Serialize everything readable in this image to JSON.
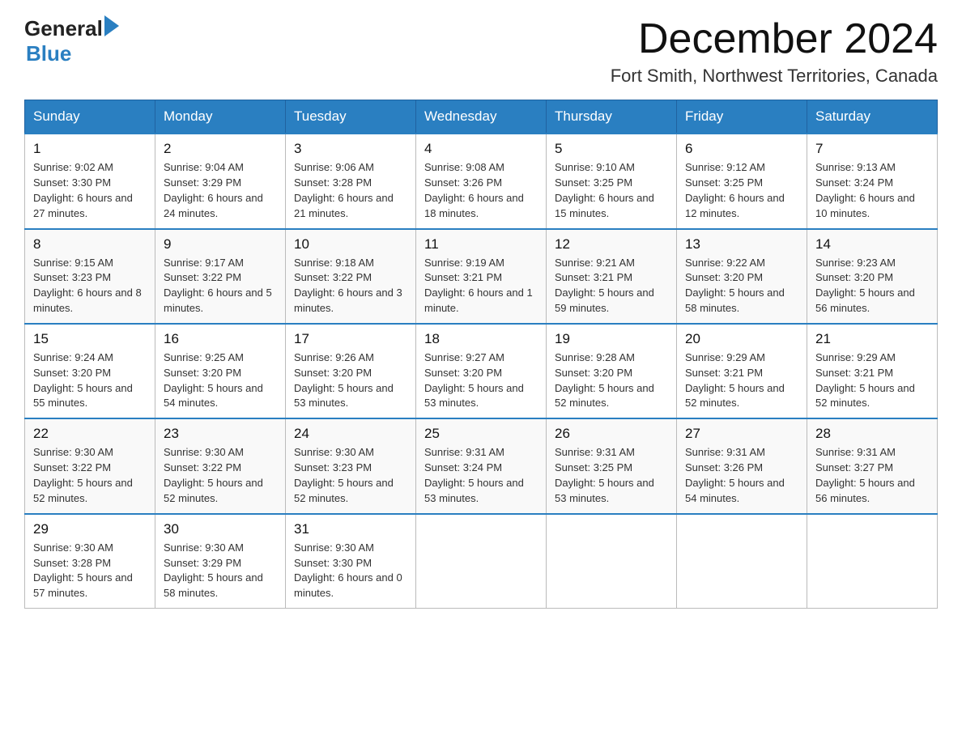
{
  "header": {
    "logo_general": "General",
    "logo_blue": "Blue",
    "month_title": "December 2024",
    "location": "Fort Smith, Northwest Territories, Canada"
  },
  "weekdays": [
    "Sunday",
    "Monday",
    "Tuesday",
    "Wednesday",
    "Thursday",
    "Friday",
    "Saturday"
  ],
  "weeks": [
    [
      {
        "day": "1",
        "sunrise": "9:02 AM",
        "sunset": "3:30 PM",
        "daylight": "6 hours and 27 minutes."
      },
      {
        "day": "2",
        "sunrise": "9:04 AM",
        "sunset": "3:29 PM",
        "daylight": "6 hours and 24 minutes."
      },
      {
        "day": "3",
        "sunrise": "9:06 AM",
        "sunset": "3:28 PM",
        "daylight": "6 hours and 21 minutes."
      },
      {
        "day": "4",
        "sunrise": "9:08 AM",
        "sunset": "3:26 PM",
        "daylight": "6 hours and 18 minutes."
      },
      {
        "day": "5",
        "sunrise": "9:10 AM",
        "sunset": "3:25 PM",
        "daylight": "6 hours and 15 minutes."
      },
      {
        "day": "6",
        "sunrise": "9:12 AM",
        "sunset": "3:25 PM",
        "daylight": "6 hours and 12 minutes."
      },
      {
        "day": "7",
        "sunrise": "9:13 AM",
        "sunset": "3:24 PM",
        "daylight": "6 hours and 10 minutes."
      }
    ],
    [
      {
        "day": "8",
        "sunrise": "9:15 AM",
        "sunset": "3:23 PM",
        "daylight": "6 hours and 8 minutes."
      },
      {
        "day": "9",
        "sunrise": "9:17 AM",
        "sunset": "3:22 PM",
        "daylight": "6 hours and 5 minutes."
      },
      {
        "day": "10",
        "sunrise": "9:18 AM",
        "sunset": "3:22 PM",
        "daylight": "6 hours and 3 minutes."
      },
      {
        "day": "11",
        "sunrise": "9:19 AM",
        "sunset": "3:21 PM",
        "daylight": "6 hours and 1 minute."
      },
      {
        "day": "12",
        "sunrise": "9:21 AM",
        "sunset": "3:21 PM",
        "daylight": "5 hours and 59 minutes."
      },
      {
        "day": "13",
        "sunrise": "9:22 AM",
        "sunset": "3:20 PM",
        "daylight": "5 hours and 58 minutes."
      },
      {
        "day": "14",
        "sunrise": "9:23 AM",
        "sunset": "3:20 PM",
        "daylight": "5 hours and 56 minutes."
      }
    ],
    [
      {
        "day": "15",
        "sunrise": "9:24 AM",
        "sunset": "3:20 PM",
        "daylight": "5 hours and 55 minutes."
      },
      {
        "day": "16",
        "sunrise": "9:25 AM",
        "sunset": "3:20 PM",
        "daylight": "5 hours and 54 minutes."
      },
      {
        "day": "17",
        "sunrise": "9:26 AM",
        "sunset": "3:20 PM",
        "daylight": "5 hours and 53 minutes."
      },
      {
        "day": "18",
        "sunrise": "9:27 AM",
        "sunset": "3:20 PM",
        "daylight": "5 hours and 53 minutes."
      },
      {
        "day": "19",
        "sunrise": "9:28 AM",
        "sunset": "3:20 PM",
        "daylight": "5 hours and 52 minutes."
      },
      {
        "day": "20",
        "sunrise": "9:29 AM",
        "sunset": "3:21 PM",
        "daylight": "5 hours and 52 minutes."
      },
      {
        "day": "21",
        "sunrise": "9:29 AM",
        "sunset": "3:21 PM",
        "daylight": "5 hours and 52 minutes."
      }
    ],
    [
      {
        "day": "22",
        "sunrise": "9:30 AM",
        "sunset": "3:22 PM",
        "daylight": "5 hours and 52 minutes."
      },
      {
        "day": "23",
        "sunrise": "9:30 AM",
        "sunset": "3:22 PM",
        "daylight": "5 hours and 52 minutes."
      },
      {
        "day": "24",
        "sunrise": "9:30 AM",
        "sunset": "3:23 PM",
        "daylight": "5 hours and 52 minutes."
      },
      {
        "day": "25",
        "sunrise": "9:31 AM",
        "sunset": "3:24 PM",
        "daylight": "5 hours and 53 minutes."
      },
      {
        "day": "26",
        "sunrise": "9:31 AM",
        "sunset": "3:25 PM",
        "daylight": "5 hours and 53 minutes."
      },
      {
        "day": "27",
        "sunrise": "9:31 AM",
        "sunset": "3:26 PM",
        "daylight": "5 hours and 54 minutes."
      },
      {
        "day": "28",
        "sunrise": "9:31 AM",
        "sunset": "3:27 PM",
        "daylight": "5 hours and 56 minutes."
      }
    ],
    [
      {
        "day": "29",
        "sunrise": "9:30 AM",
        "sunset": "3:28 PM",
        "daylight": "5 hours and 57 minutes."
      },
      {
        "day": "30",
        "sunrise": "9:30 AM",
        "sunset": "3:29 PM",
        "daylight": "5 hours and 58 minutes."
      },
      {
        "day": "31",
        "sunrise": "9:30 AM",
        "sunset": "3:30 PM",
        "daylight": "6 hours and 0 minutes."
      },
      null,
      null,
      null,
      null
    ]
  ],
  "labels": {
    "sunrise_prefix": "Sunrise: ",
    "sunset_prefix": "Sunset: ",
    "daylight_prefix": "Daylight: "
  }
}
